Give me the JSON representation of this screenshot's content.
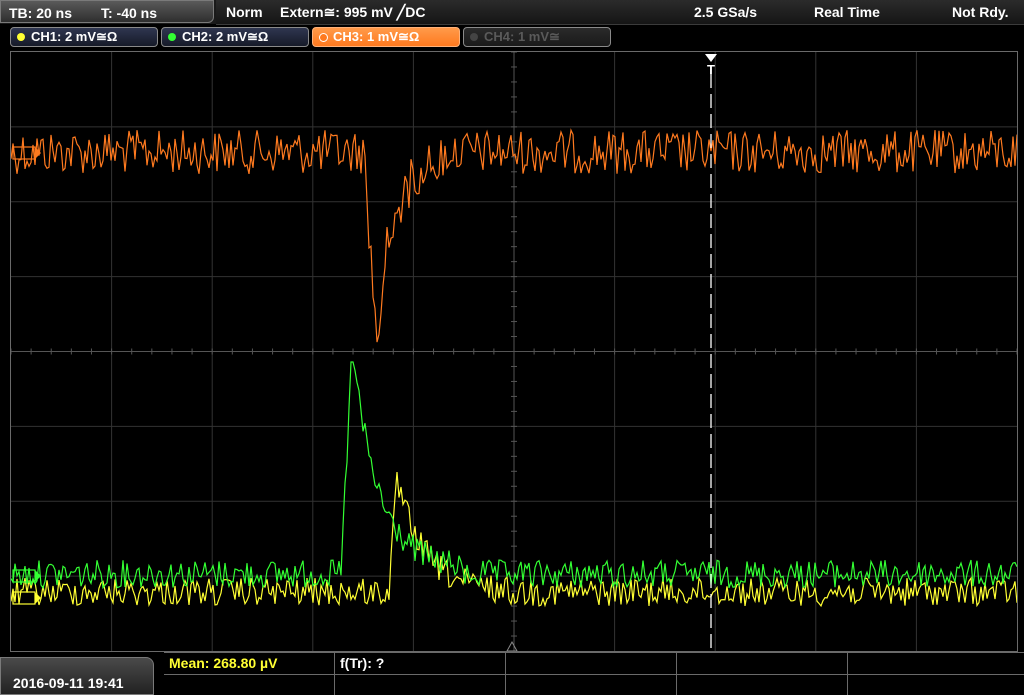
{
  "header": {
    "timebase": "TB: 20 ns",
    "trigger_time": "T: -40 ns",
    "trigger_mode": "Norm",
    "trigger_source": "Extern≅: 995 mV ╱DC",
    "sample_rate": "2.5 GSa/s",
    "acq_mode": "Real Time",
    "run_state": "Not Rdy."
  },
  "channels": [
    {
      "label": "CH1: 2 mV≅Ω",
      "color": "#ffff33",
      "active": false
    },
    {
      "label": "CH2: 2 mV≅Ω",
      "color": "#33ff33",
      "active": false
    },
    {
      "label": "CH3: 1 mV≅Ω",
      "color": "#ff7a1f",
      "active": true
    },
    {
      "label": "CH4: 1 mV≅",
      "color": "#555555",
      "active": false
    }
  ],
  "trigger_marker": "T",
  "footer": {
    "datetime": "2016-09-11 19:41",
    "mean_label": "Mean: 268.80 µV",
    "ftr_label": "f(Tr): ?"
  },
  "colors": {
    "ch1": "#ffff33",
    "ch2": "#33ff33",
    "ch3": "#ff7a1f",
    "grid": "#3a3a3a",
    "grid_center": "#6a6a6a"
  }
}
